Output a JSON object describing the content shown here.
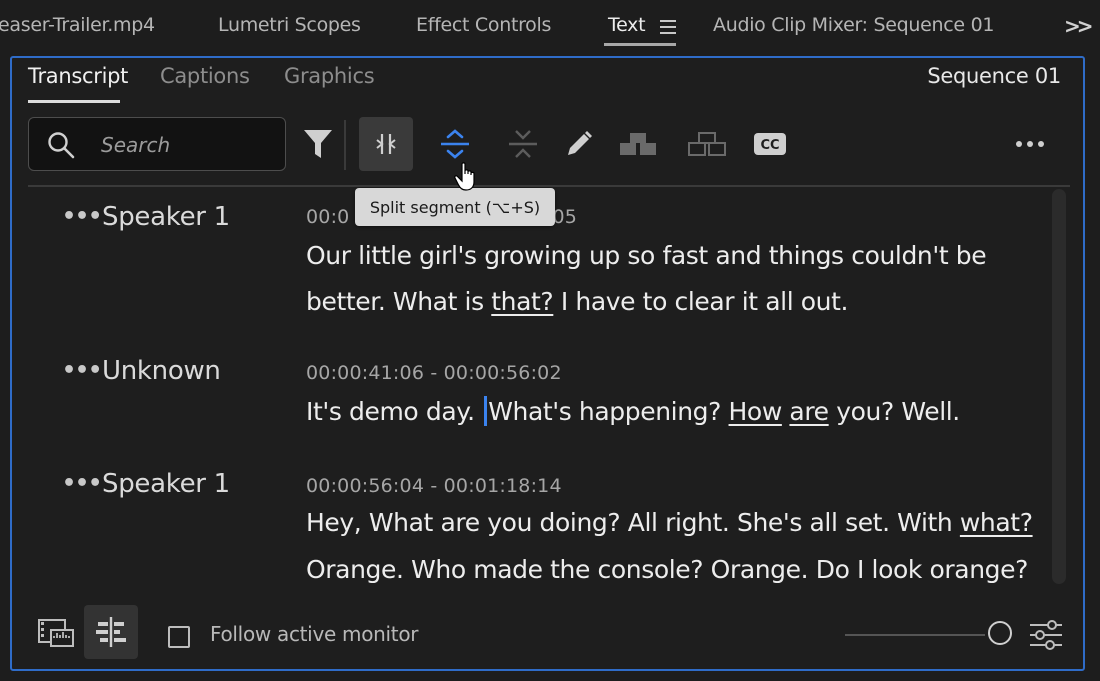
{
  "panel_tabs": [
    {
      "label": "easer-Trailer.mp4"
    },
    {
      "label": "Lumetri Scopes"
    },
    {
      "label": "Effect Controls"
    },
    {
      "label": "Text"
    },
    {
      "label": "Audio Clip Mixer: Sequence 01"
    }
  ],
  "active_panel_tab": "Text",
  "subtabs": [
    {
      "label": "Transcript"
    },
    {
      "label": "Captions"
    },
    {
      "label": "Graphics"
    }
  ],
  "sequence_label": "Sequence 01",
  "search": {
    "placeholder": "Search"
  },
  "toolbar_icons": [
    "filter-icon",
    "merge-segments-icon",
    "split-segment-icon",
    "collapse-icon",
    "edit-pencil-icon",
    "speakers-icon",
    "speakers-alt-icon",
    "cc-icon",
    "more-icon"
  ],
  "tooltip": "Split segment (⌥+S)",
  "segments": [
    {
      "speaker": "Speaker 1",
      "timecode": "00:0",
      "timecode_tail": "05",
      "lines": [
        {
          "parts": [
            {
              "t": "Our little girl's growing up so fast and things couldn't be"
            }
          ]
        },
        {
          "parts": [
            {
              "t": "better. What is "
            },
            {
              "t": "that?",
              "u": true
            },
            {
              "t": " I have to clear it all out."
            }
          ]
        }
      ]
    },
    {
      "speaker": "Unknown",
      "timecode": "00:00:41:06 - 00:00:56:02",
      "lines": [
        {
          "parts": [
            {
              "t": "It's demo day. "
            },
            {
              "caret": true
            },
            {
              "t": "What's happening? "
            },
            {
              "t": "How",
              "u": true
            },
            {
              "t": " "
            },
            {
              "t": "are",
              "u": true
            },
            {
              "t": " you? Well."
            }
          ]
        }
      ]
    },
    {
      "speaker": "Speaker 1",
      "timecode": "00:00:56:04 - 00:01:18:14",
      "lines": [
        {
          "parts": [
            {
              "t": "Hey, What are you doing? All right. She's all set. With "
            },
            {
              "t": "what?",
              "u": true
            }
          ]
        },
        {
          "parts": [
            {
              "t": "Orange. Who made the console? Orange. Do I look orange?"
            }
          ]
        }
      ]
    }
  ],
  "footer": {
    "follow_label": "Follow active monitor",
    "follow_checked": false
  },
  "colors": {
    "accent": "#2f6cc8",
    "caret": "#3b83ee"
  }
}
